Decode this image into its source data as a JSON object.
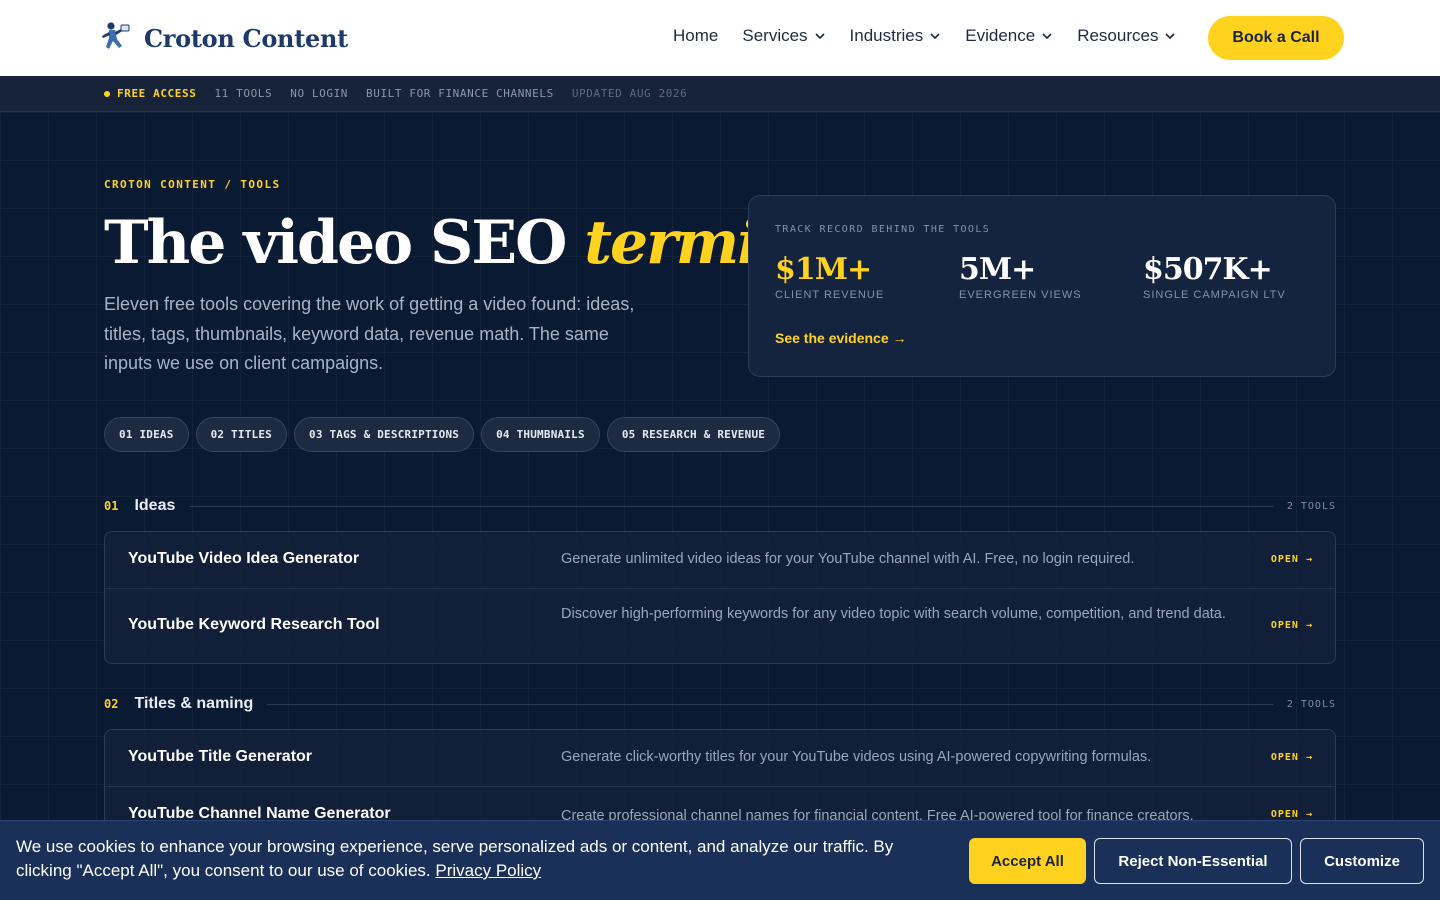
{
  "brand": {
    "name": "Croton Content",
    "logo_icon": "runner-mascot-icon"
  },
  "nav": {
    "items": [
      {
        "label": "Home",
        "has_dropdown": false
      },
      {
        "label": "Services",
        "has_dropdown": true
      },
      {
        "label": "Industries",
        "has_dropdown": true
      },
      {
        "label": "Evidence",
        "has_dropdown": true
      },
      {
        "label": "Resources",
        "has_dropdown": true
      }
    ],
    "cta_label": "Book a Call"
  },
  "strip": {
    "free": "FREE ACCESS",
    "tools": "11 TOOLS",
    "login": "NO LOGIN",
    "built": "BUILT FOR FINANCE CHANNELS",
    "updated": "UPDATED AUG 2026"
  },
  "hero": {
    "breadcrumb": "CROTON CONTENT / TOOLS",
    "title_main": "The video SEO",
    "title_accent": "terminal",
    "subtitle": "Eleven free tools covering the work of getting a video found: ideas, titles, tags, thumbnails, keyword data, revenue math. The same inputs we use on client campaigns."
  },
  "track_record": {
    "label": "TRACK RECORD BEHIND THE TOOLS",
    "stats": [
      {
        "value": "$1M+",
        "caption": "CLIENT REVENUE"
      },
      {
        "value": "5M+",
        "caption": "EVERGREEN VIEWS"
      },
      {
        "value": "$507K+",
        "caption": "SINGLE CAMPAIGN LTV"
      }
    ],
    "link": "See the evidence →"
  },
  "chips": [
    "01 IDEAS",
    "02 TITLES",
    "03 TAGS & DESCRIPTIONS",
    "04 THUMBNAILS",
    "05 RESEARCH & REVENUE"
  ],
  "sections": [
    {
      "num": "01",
      "name": "Ideas",
      "count": "2 TOOLS",
      "tools": [
        {
          "title": "YouTube Video Idea Generator",
          "desc": "Generate unlimited video ideas for your YouTube channel with AI. Free, no login required.",
          "action": "OPEN →"
        },
        {
          "title": "YouTube Keyword Research Tool",
          "desc": "Discover high-performing keywords for any video topic with search volume, competition, and trend data.",
          "action": "OPEN →"
        }
      ]
    },
    {
      "num": "02",
      "name": "Titles & naming",
      "count": "2 TOOLS",
      "tools": [
        {
          "title": "YouTube Title Generator",
          "desc": "Generate click-worthy titles for your YouTube videos using AI-powered copywriting formulas.",
          "action": "OPEN →"
        },
        {
          "title": "YouTube Channel Name Generator",
          "desc": "Create professional channel names for financial content. Free AI-powered tool for finance creators.",
          "action": "OPEN →"
        }
      ]
    }
  ],
  "cookie": {
    "text": "We use cookies to enhance your browsing experience, serve personalized ads or content, and analyze our traffic. By clicking \"Accept All\", you consent to our use of cookies.",
    "policy_link": "Privacy Policy",
    "accept": "Accept All",
    "reject": "Reject Non-Essential",
    "customize": "Customize"
  },
  "colors": {
    "accent": "#ffd21f",
    "navy": "#0b1a33",
    "brand_text": "#1d3a6b"
  }
}
